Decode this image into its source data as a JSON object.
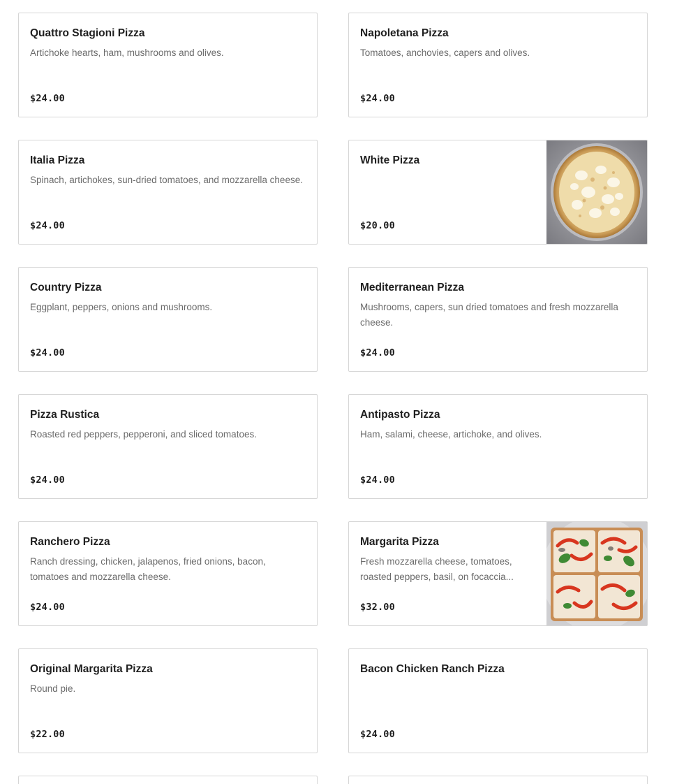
{
  "menu": {
    "items": [
      {
        "name": "Quattro Stagioni Pizza",
        "description": "Artichoke hearts, ham, mushrooms and olives.",
        "price": "$24.00"
      },
      {
        "name": "Napoletana Pizza",
        "description": "Tomatoes, anchovies, capers and olives.",
        "price": "$24.00"
      },
      {
        "name": "Italia Pizza",
        "description": "Spinach, artichokes, sun-dried tomatoes, and mozzarella cheese.",
        "price": "$24.00"
      },
      {
        "name": "White Pizza",
        "description": "",
        "price": "$20.00",
        "image": "white-pizza-photo"
      },
      {
        "name": "Country Pizza",
        "description": "Eggplant, peppers, onions and mushrooms.",
        "price": "$24.00"
      },
      {
        "name": "Mediterranean Pizza",
        "description": "Mushrooms, capers, sun dried tomatoes and fresh mozzarella cheese.",
        "price": "$24.00"
      },
      {
        "name": "Pizza Rustica",
        "description": "Roasted red peppers, pepperoni, and sliced tomatoes.",
        "price": "$24.00"
      },
      {
        "name": "Antipasto Pizza",
        "description": "Ham, salami, cheese, artichoke, and olives.",
        "price": "$24.00"
      },
      {
        "name": "Ranchero Pizza",
        "description": "Ranch dressing, chicken, jalapenos, fried onions, bacon, tomatoes and mozzarella cheese.",
        "price": "$24.00"
      },
      {
        "name": "Margarita Pizza",
        "description": "Fresh mozzarella cheese, tomatoes, roasted peppers, basil, on focaccia...",
        "price": "$32.00",
        "image": "margarita-pizza-photo"
      },
      {
        "name": "Original Margarita Pizza",
        "description": "Round pie.",
        "price": "$22.00"
      },
      {
        "name": "Bacon Chicken Ranch Pizza",
        "description": "",
        "price": "$24.00"
      }
    ]
  }
}
